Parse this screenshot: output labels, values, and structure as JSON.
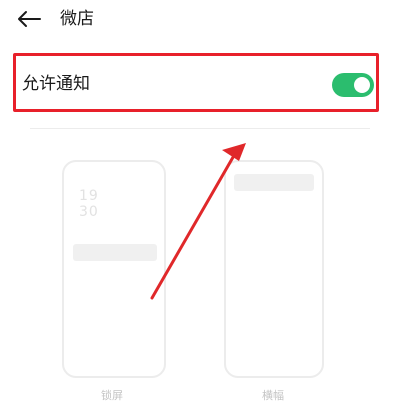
{
  "header": {
    "back_icon": "arrow-left-icon",
    "title": "微店"
  },
  "setting": {
    "label": "允许通知",
    "toggle_state": "on"
  },
  "previews": {
    "lock_screen": {
      "time_line1": "19",
      "time_line2": "30",
      "caption": "锁屏"
    },
    "banner": {
      "caption": "横幅"
    }
  },
  "colors": {
    "highlight_border": "#e8202a",
    "toggle_on": "#2bbd6e",
    "annotation_arrow": "#e0282a"
  }
}
